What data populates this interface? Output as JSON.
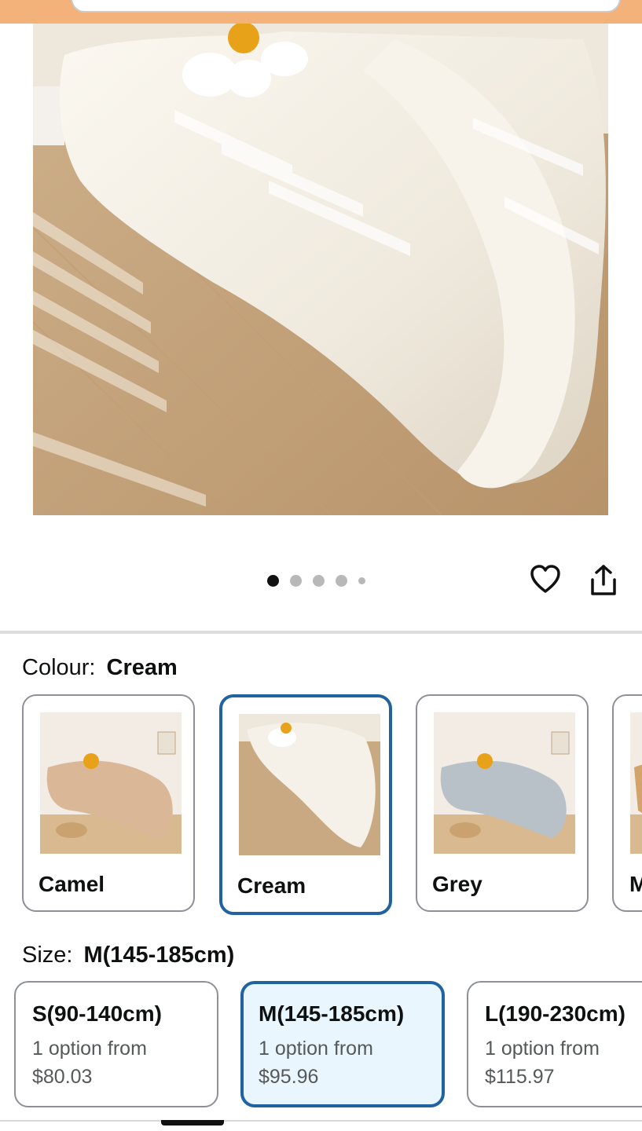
{
  "gallery": {
    "image_alt": "Cream curved boucle sofa",
    "dot_count": 5,
    "active_dot": 0,
    "wishlist_icon": "heart-icon",
    "share_icon": "share-icon"
  },
  "colour": {
    "label": "Colour:",
    "selected": "Cream",
    "options": [
      {
        "name": "Camel",
        "swatch_color": "#d9b797"
      },
      {
        "name": "Cream",
        "swatch_color": "#f3efe6"
      },
      {
        "name": "Grey",
        "swatch_color": "#b9c1c8"
      }
    ]
  },
  "size": {
    "label": "Size:",
    "selected": "M(145-185cm)",
    "options": [
      {
        "name": "S(90-140cm)",
        "sub": "1 option from",
        "price": "$80.03"
      },
      {
        "name": "M(145-185cm)",
        "sub": "1 option from",
        "price": "$95.96"
      },
      {
        "name": "L(190-230cm)",
        "sub": "1 option from",
        "price": "$115.97"
      }
    ]
  },
  "colors": {
    "accent": "#2162a1",
    "selected_bg": "#eaf6fd",
    "top_bar": "#f3b27a"
  }
}
